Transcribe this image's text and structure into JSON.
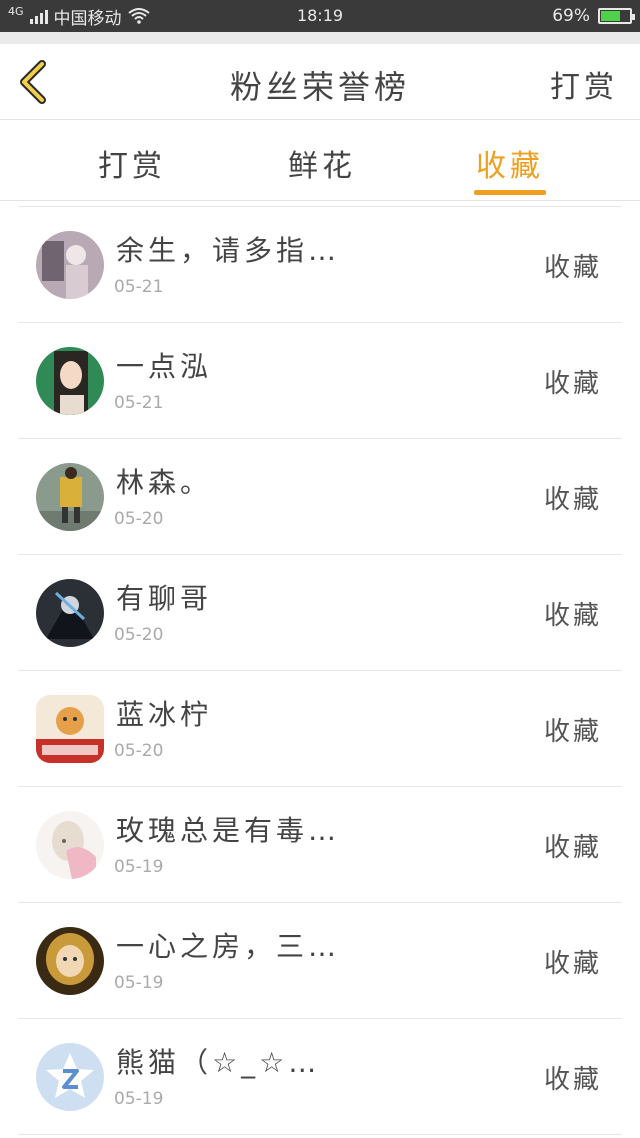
{
  "status_bar": {
    "network": "4G",
    "carrier": "中国移动",
    "time": "18:19",
    "battery": "69%",
    "battery_level": 0.69,
    "icons": [
      "signal-icon",
      "wifi-icon",
      "battery-icon"
    ]
  },
  "header": {
    "title": "粉丝荣誉榜",
    "right_button": "打赏",
    "back_icon": "chevron-left-icon",
    "accent_color": "#f0a020"
  },
  "tabs": [
    {
      "label": "打赏",
      "active": false
    },
    {
      "label": "鲜花",
      "active": false
    },
    {
      "label": "收藏",
      "active": true
    }
  ],
  "items": [
    {
      "name": "余生，请多指…",
      "date": "05-21",
      "action": "收藏",
      "avatar_color": "#b8a9b4"
    },
    {
      "name": "一点泓",
      "date": "05-21",
      "action": "收藏",
      "avatar_color": "#2f8a55"
    },
    {
      "name": "林森。",
      "date": "05-20",
      "action": "收藏",
      "avatar_color": "#c8a948"
    },
    {
      "name": "有聊哥",
      "date": "05-20",
      "action": "收藏",
      "avatar_color": "#2b2f36"
    },
    {
      "name": "蓝冰柠",
      "date": "05-20",
      "action": "收藏",
      "avatar_color": "#d8433a"
    },
    {
      "name": "玫瑰总是有毒…",
      "date": "05-19",
      "action": "收藏",
      "avatar_color": "#e9c9cf"
    },
    {
      "name": "一心之房，三…",
      "date": "05-19",
      "action": "收藏",
      "avatar_color": "#6b4a1c"
    },
    {
      "name": "熊猫（☆_☆…",
      "date": "05-19",
      "action": "收藏",
      "avatar_color": "#cfdff2"
    }
  ]
}
